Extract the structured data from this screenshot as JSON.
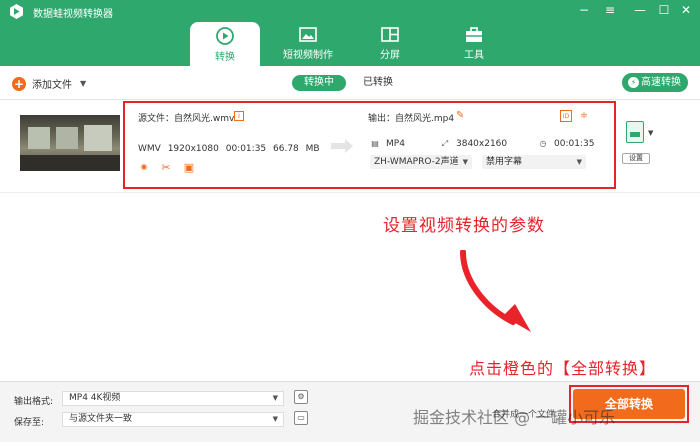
{
  "app": {
    "title": "数据蛙视频转换器"
  },
  "window_controls": [
    "−",
    "≡",
    "—",
    "☐",
    "✕"
  ],
  "tabs": [
    {
      "label": "转换",
      "icon": "convert-icon",
      "active": true
    },
    {
      "label": "短视频制作",
      "icon": "image-icon",
      "active": false
    },
    {
      "label": "分屏",
      "icon": "split-screen-icon",
      "active": false
    },
    {
      "label": "工具",
      "icon": "toolbox-icon",
      "active": false
    }
  ],
  "toolbar": {
    "add_file": "添加文件",
    "converting": "转换中",
    "converted": "已转换",
    "high_speed": "高速转换"
  },
  "file": {
    "source_label": "源文件：自然风光.wmv",
    "output_label": "输出：自然风光.mp4",
    "src_format": "WMV",
    "src_resolution": "1920x1080",
    "src_duration": "00:01:35",
    "src_size": "66.78 MB",
    "out_format": "MP4",
    "out_resolution": "3840x2160",
    "out_duration": "00:01:35",
    "audio_track": "ZH-WMAPRO-2声道",
    "subtitle": "禁用字幕",
    "settings_label": "设置"
  },
  "annotations": {
    "set_params": "设置视频转换的参数",
    "click_convert": "点击橙色的【全部转换】"
  },
  "bottom": {
    "output_format_label": "输出格式:",
    "output_format_value": "MP4 4K视频",
    "save_to_label": "保存至:",
    "save_to_value": "与源文件夹一致",
    "merge_label": "合并成一个文件",
    "convert_all": "全部转换"
  },
  "watermark": "掘金技术社区 @ 一罐小可乐",
  "colors": {
    "brand_green": "#2fa86e",
    "accent_orange": "#f26b1d",
    "annotation_red": "#e8232a"
  }
}
